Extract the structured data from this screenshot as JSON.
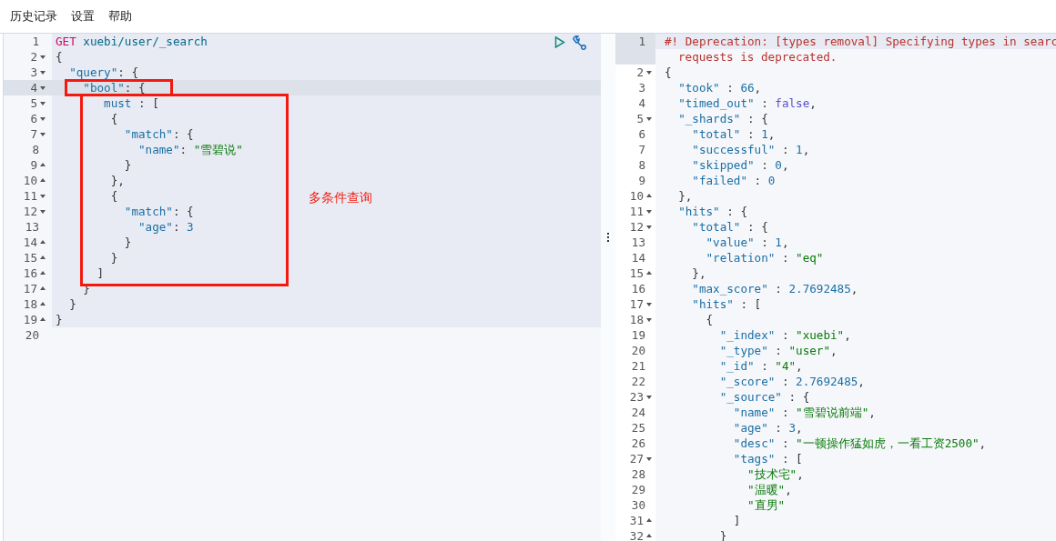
{
  "menu": [
    {
      "label": "历史记录"
    },
    {
      "label": "设置"
    },
    {
      "label": "帮助"
    }
  ],
  "request": {
    "lines": [
      {
        "number": "1",
        "fold_start": false,
        "fold_end": false,
        "selected": false,
        "in_request": true,
        "tokens": [
          {
            "kind": "method",
            "text": "GET "
          },
          {
            "kind": "url",
            "text": "xuebi/user/_search"
          }
        ]
      },
      {
        "number": "2",
        "fold_start": true,
        "fold_end": false,
        "selected": false,
        "in_request": true,
        "tokens": [
          {
            "kind": "punct",
            "text": "{"
          }
        ]
      },
      {
        "number": "3",
        "fold_start": true,
        "fold_end": false,
        "selected": false,
        "in_request": true,
        "tokens": [
          {
            "kind": "key",
            "text": "  \"query\""
          },
          {
            "kind": "punct",
            "text": ": {"
          }
        ]
      },
      {
        "number": "4",
        "fold_start": true,
        "fold_end": false,
        "selected": true,
        "in_request": true,
        "tokens": [
          {
            "kind": "key",
            "text": "    \"bool\""
          },
          {
            "kind": "punct",
            "text": ": {"
          }
        ]
      },
      {
        "number": "5",
        "fold_start": true,
        "fold_end": false,
        "selected": false,
        "in_request": true,
        "tokens": [
          {
            "kind": "key",
            "text": "       must"
          },
          {
            "kind": "punct",
            "text": " : ["
          }
        ]
      },
      {
        "number": "6",
        "fold_start": true,
        "fold_end": false,
        "selected": false,
        "in_request": true,
        "tokens": [
          {
            "kind": "punct",
            "text": "        {"
          }
        ]
      },
      {
        "number": "7",
        "fold_start": true,
        "fold_end": false,
        "selected": false,
        "in_request": true,
        "tokens": [
          {
            "kind": "key",
            "text": "          \"match\""
          },
          {
            "kind": "punct",
            "text": ": {"
          }
        ]
      },
      {
        "number": "8",
        "fold_start": false,
        "fold_end": false,
        "selected": false,
        "in_request": true,
        "tokens": [
          {
            "kind": "key",
            "text": "            \"name\""
          },
          {
            "kind": "punct",
            "text": ": "
          },
          {
            "kind": "string",
            "text": "\"雪碧说\""
          }
        ]
      },
      {
        "number": "9",
        "fold_start": false,
        "fold_end": true,
        "selected": false,
        "in_request": true,
        "tokens": [
          {
            "kind": "punct",
            "text": "          }"
          }
        ]
      },
      {
        "number": "10",
        "fold_start": false,
        "fold_end": true,
        "selected": false,
        "in_request": true,
        "tokens": [
          {
            "kind": "punct",
            "text": "        },"
          }
        ]
      },
      {
        "number": "11",
        "fold_start": true,
        "fold_end": false,
        "selected": false,
        "in_request": true,
        "tokens": [
          {
            "kind": "punct",
            "text": "        {"
          }
        ]
      },
      {
        "number": "12",
        "fold_start": true,
        "fold_end": false,
        "selected": false,
        "in_request": true,
        "tokens": [
          {
            "kind": "key",
            "text": "          \"match\""
          },
          {
            "kind": "punct",
            "text": ": {"
          }
        ]
      },
      {
        "number": "13",
        "fold_start": false,
        "fold_end": false,
        "selected": false,
        "in_request": true,
        "tokens": [
          {
            "kind": "key",
            "text": "            \"age\""
          },
          {
            "kind": "punct",
            "text": ": "
          },
          {
            "kind": "number",
            "text": "3"
          }
        ]
      },
      {
        "number": "14",
        "fold_start": false,
        "fold_end": true,
        "selected": false,
        "in_request": true,
        "tokens": [
          {
            "kind": "punct",
            "text": "          }"
          }
        ]
      },
      {
        "number": "15",
        "fold_start": false,
        "fold_end": true,
        "selected": false,
        "in_request": true,
        "tokens": [
          {
            "kind": "punct",
            "text": "        }"
          }
        ]
      },
      {
        "number": "16",
        "fold_start": false,
        "fold_end": true,
        "selected": false,
        "in_request": true,
        "tokens": [
          {
            "kind": "punct",
            "text": "      ]"
          }
        ]
      },
      {
        "number": "17",
        "fold_start": false,
        "fold_end": true,
        "selected": false,
        "in_request": true,
        "tokens": [
          {
            "kind": "punct",
            "text": "    }"
          }
        ]
      },
      {
        "number": "18",
        "fold_start": false,
        "fold_end": true,
        "selected": false,
        "in_request": true,
        "tokens": [
          {
            "kind": "punct",
            "text": "  }"
          }
        ]
      },
      {
        "number": "19",
        "fold_start": false,
        "fold_end": true,
        "selected": false,
        "in_request": true,
        "tokens": [
          {
            "kind": "punct",
            "text": "}"
          }
        ]
      },
      {
        "number": "20",
        "fold_start": false,
        "fold_end": false,
        "selected": false,
        "in_request": false
      }
    ],
    "note": "多条件查询"
  },
  "response": {
    "lines": [
      {
        "number": "1",
        "fold_start": false,
        "fold_end": false,
        "selected": true,
        "tokens": [
          {
            "kind": "warning",
            "text": "#! Deprecation: [types removal] Specifying types in searc"
          }
        ],
        "continuation": "requests is deprecated."
      },
      {
        "number": "2",
        "fold_start": true,
        "fold_end": false,
        "selected": false,
        "tokens": [
          {
            "kind": "punct",
            "text": "{"
          }
        ]
      },
      {
        "number": "3",
        "fold_start": false,
        "fold_end": false,
        "selected": false,
        "tokens": [
          {
            "kind": "key",
            "text": "  \"took\""
          },
          {
            "kind": "punct",
            "text": " : "
          },
          {
            "kind": "number",
            "text": "66"
          },
          {
            "kind": "punct",
            "text": ","
          }
        ]
      },
      {
        "number": "4",
        "fold_start": false,
        "fold_end": false,
        "selected": false,
        "tokens": [
          {
            "kind": "key",
            "text": "  \"timed_out\""
          },
          {
            "kind": "punct",
            "text": " : "
          },
          {
            "kind": "boolean",
            "text": "false"
          },
          {
            "kind": "punct",
            "text": ","
          }
        ]
      },
      {
        "number": "5",
        "fold_start": true,
        "fold_end": false,
        "selected": false,
        "tokens": [
          {
            "kind": "key",
            "text": "  \"_shards\""
          },
          {
            "kind": "punct",
            "text": " : {"
          }
        ]
      },
      {
        "number": "6",
        "fold_start": false,
        "fold_end": false,
        "selected": false,
        "tokens": [
          {
            "kind": "key",
            "text": "    \"total\""
          },
          {
            "kind": "punct",
            "text": " : "
          },
          {
            "kind": "number",
            "text": "1"
          },
          {
            "kind": "punct",
            "text": ","
          }
        ]
      },
      {
        "number": "7",
        "fold_start": false,
        "fold_end": false,
        "selected": false,
        "tokens": [
          {
            "kind": "key",
            "text": "    \"successful\""
          },
          {
            "kind": "punct",
            "text": " : "
          },
          {
            "kind": "number",
            "text": "1"
          },
          {
            "kind": "punct",
            "text": ","
          }
        ]
      },
      {
        "number": "8",
        "fold_start": false,
        "fold_end": false,
        "selected": false,
        "tokens": [
          {
            "kind": "key",
            "text": "    \"skipped\""
          },
          {
            "kind": "punct",
            "text": " : "
          },
          {
            "kind": "number",
            "text": "0"
          },
          {
            "kind": "punct",
            "text": ","
          }
        ]
      },
      {
        "number": "9",
        "fold_start": false,
        "fold_end": false,
        "selected": false,
        "tokens": [
          {
            "kind": "key",
            "text": "    \"failed\""
          },
          {
            "kind": "punct",
            "text": " : "
          },
          {
            "kind": "number",
            "text": "0"
          }
        ]
      },
      {
        "number": "10",
        "fold_start": false,
        "fold_end": true,
        "selected": false,
        "tokens": [
          {
            "kind": "punct",
            "text": "  },"
          }
        ]
      },
      {
        "number": "11",
        "fold_start": true,
        "fold_end": false,
        "selected": false,
        "tokens": [
          {
            "kind": "key",
            "text": "  \"hits\""
          },
          {
            "kind": "punct",
            "text": " : {"
          }
        ]
      },
      {
        "number": "12",
        "fold_start": true,
        "fold_end": false,
        "selected": false,
        "tokens": [
          {
            "kind": "key",
            "text": "    \"total\""
          },
          {
            "kind": "punct",
            "text": " : {"
          }
        ]
      },
      {
        "number": "13",
        "fold_start": false,
        "fold_end": false,
        "selected": false,
        "tokens": [
          {
            "kind": "key",
            "text": "      \"value\""
          },
          {
            "kind": "punct",
            "text": " : "
          },
          {
            "kind": "number",
            "text": "1"
          },
          {
            "kind": "punct",
            "text": ","
          }
        ]
      },
      {
        "number": "14",
        "fold_start": false,
        "fold_end": false,
        "selected": false,
        "tokens": [
          {
            "kind": "key",
            "text": "      \"relation\""
          },
          {
            "kind": "punct",
            "text": " : "
          },
          {
            "kind": "string",
            "text": "\"eq\""
          }
        ]
      },
      {
        "number": "15",
        "fold_start": false,
        "fold_end": true,
        "selected": false,
        "tokens": [
          {
            "kind": "punct",
            "text": "    },"
          }
        ]
      },
      {
        "number": "16",
        "fold_start": false,
        "fold_end": false,
        "selected": false,
        "tokens": [
          {
            "kind": "key",
            "text": "    \"max_score\""
          },
          {
            "kind": "punct",
            "text": " : "
          },
          {
            "kind": "number",
            "text": "2.7692485"
          },
          {
            "kind": "punct",
            "text": ","
          }
        ]
      },
      {
        "number": "17",
        "fold_start": true,
        "fold_end": false,
        "selected": false,
        "tokens": [
          {
            "kind": "key",
            "text": "    \"hits\""
          },
          {
            "kind": "punct",
            "text": " : ["
          }
        ]
      },
      {
        "number": "18",
        "fold_start": true,
        "fold_end": false,
        "selected": false,
        "tokens": [
          {
            "kind": "punct",
            "text": "      {"
          }
        ]
      },
      {
        "number": "19",
        "fold_start": false,
        "fold_end": false,
        "selected": false,
        "tokens": [
          {
            "kind": "key",
            "text": "        \"_index\""
          },
          {
            "kind": "punct",
            "text": " : "
          },
          {
            "kind": "string",
            "text": "\"xuebi\""
          },
          {
            "kind": "punct",
            "text": ","
          }
        ]
      },
      {
        "number": "20",
        "fold_start": false,
        "fold_end": false,
        "selected": false,
        "tokens": [
          {
            "kind": "key",
            "text": "        \"_type\""
          },
          {
            "kind": "punct",
            "text": " : "
          },
          {
            "kind": "string",
            "text": "\"user\""
          },
          {
            "kind": "punct",
            "text": ","
          }
        ]
      },
      {
        "number": "21",
        "fold_start": false,
        "fold_end": false,
        "selected": false,
        "tokens": [
          {
            "kind": "key",
            "text": "        \"_id\""
          },
          {
            "kind": "punct",
            "text": " : "
          },
          {
            "kind": "string",
            "text": "\"4\""
          },
          {
            "kind": "punct",
            "text": ","
          }
        ]
      },
      {
        "number": "22",
        "fold_start": false,
        "fold_end": false,
        "selected": false,
        "tokens": [
          {
            "kind": "key",
            "text": "        \"_score\""
          },
          {
            "kind": "punct",
            "text": " : "
          },
          {
            "kind": "number",
            "text": "2.7692485"
          },
          {
            "kind": "punct",
            "text": ","
          }
        ]
      },
      {
        "number": "23",
        "fold_start": true,
        "fold_end": false,
        "selected": false,
        "tokens": [
          {
            "kind": "key",
            "text": "        \"_source\""
          },
          {
            "kind": "punct",
            "text": " : {"
          }
        ]
      },
      {
        "number": "24",
        "fold_start": false,
        "fold_end": false,
        "selected": false,
        "tokens": [
          {
            "kind": "key",
            "text": "          \"name\""
          },
          {
            "kind": "punct",
            "text": " : "
          },
          {
            "kind": "string",
            "text": "\"雪碧说前端\""
          },
          {
            "kind": "punct",
            "text": ","
          }
        ]
      },
      {
        "number": "25",
        "fold_start": false,
        "fold_end": false,
        "selected": false,
        "tokens": [
          {
            "kind": "key",
            "text": "          \"age\""
          },
          {
            "kind": "punct",
            "text": " : "
          },
          {
            "kind": "number",
            "text": "3"
          },
          {
            "kind": "punct",
            "text": ","
          }
        ]
      },
      {
        "number": "26",
        "fold_start": false,
        "fold_end": false,
        "selected": false,
        "tokens": [
          {
            "kind": "key",
            "text": "          \"desc\""
          },
          {
            "kind": "punct",
            "text": " : "
          },
          {
            "kind": "string",
            "text": "\"一顿操作猛如虎，一看工资2500\""
          },
          {
            "kind": "punct",
            "text": ","
          }
        ]
      },
      {
        "number": "27",
        "fold_start": true,
        "fold_end": false,
        "selected": false,
        "tokens": [
          {
            "kind": "key",
            "text": "          \"tags\""
          },
          {
            "kind": "punct",
            "text": " : ["
          }
        ]
      },
      {
        "number": "28",
        "fold_start": false,
        "fold_end": false,
        "selected": false,
        "tokens": [
          {
            "kind": "string",
            "text": "            \"技术宅\""
          },
          {
            "kind": "punct",
            "text": ","
          }
        ]
      },
      {
        "number": "29",
        "fold_start": false,
        "fold_end": false,
        "selected": false,
        "tokens": [
          {
            "kind": "string",
            "text": "            \"温暖\""
          },
          {
            "kind": "punct",
            "text": ","
          }
        ]
      },
      {
        "number": "30",
        "fold_start": false,
        "fold_end": false,
        "selected": false,
        "tokens": [
          {
            "kind": "string",
            "text": "            \"直男\""
          }
        ]
      },
      {
        "number": "31",
        "fold_start": false,
        "fold_end": true,
        "selected": false,
        "tokens": [
          {
            "kind": "punct",
            "text": "          ]"
          }
        ]
      },
      {
        "number": "32",
        "fold_start": false,
        "fold_end": true,
        "selected": false,
        "tokens": [
          {
            "kind": "punct",
            "text": "        }"
          }
        ]
      }
    ]
  }
}
